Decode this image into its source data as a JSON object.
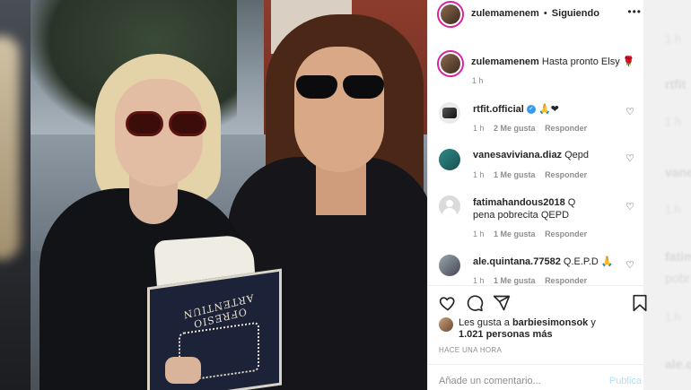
{
  "post": {
    "author": "zulemamenem",
    "separator": "•",
    "follow_status": "Siguiendo",
    "caption": "Hasta pronto Elsy",
    "caption_emoji": "🌹",
    "caption_time": "1 h"
  },
  "photo": {
    "book_title": "OFRESIO ARTENTIUN"
  },
  "comments": [
    {
      "user": "rtfit.official",
      "verified": true,
      "text": "🙏❤",
      "time": "1 h",
      "likes": "2 Me gusta",
      "reply": "Responder"
    },
    {
      "user": "vanesaviviana.diaz",
      "verified": false,
      "text": "Qepd",
      "time": "1 h",
      "likes": "1 Me gusta",
      "reply": "Responder"
    },
    {
      "user": "fatimahandous2018",
      "verified": false,
      "text": "Q pena pobrecita QEPD",
      "time": "1 h",
      "likes": "1 Me gusta",
      "reply": "Responder"
    },
    {
      "user": "ale.quintana.77582",
      "verified": false,
      "text": "Q.E.P.D 🙏",
      "time": "1 h",
      "likes": "1 Me gusta",
      "reply": "Responder"
    }
  ],
  "likes": {
    "prefix": "Les gusta a",
    "user": "barbiesimonsok",
    "conj": "y",
    "others": "1.021 personas más"
  },
  "timestamp": "HACE UNA HORA",
  "comment_input": {
    "placeholder": "Añade un comentario...",
    "publish": "Publica"
  },
  "background_ghosts": [
    "1 h",
    "rtfit",
    "1 h",
    "vanes",
    "1 h",
    "fatim",
    "pobr",
    "1 h",
    "ale.q"
  ],
  "icons": {
    "heart": "heart-icon",
    "comment": "comment-icon",
    "share": "share-icon",
    "save": "bookmark-icon",
    "more": "more-options-icon",
    "verified": "verified-icon"
  },
  "colors": {
    "accent": "#3897f0",
    "link_disabled": "#b2dffc",
    "muted": "#8e8e8e",
    "text": "#262626"
  }
}
